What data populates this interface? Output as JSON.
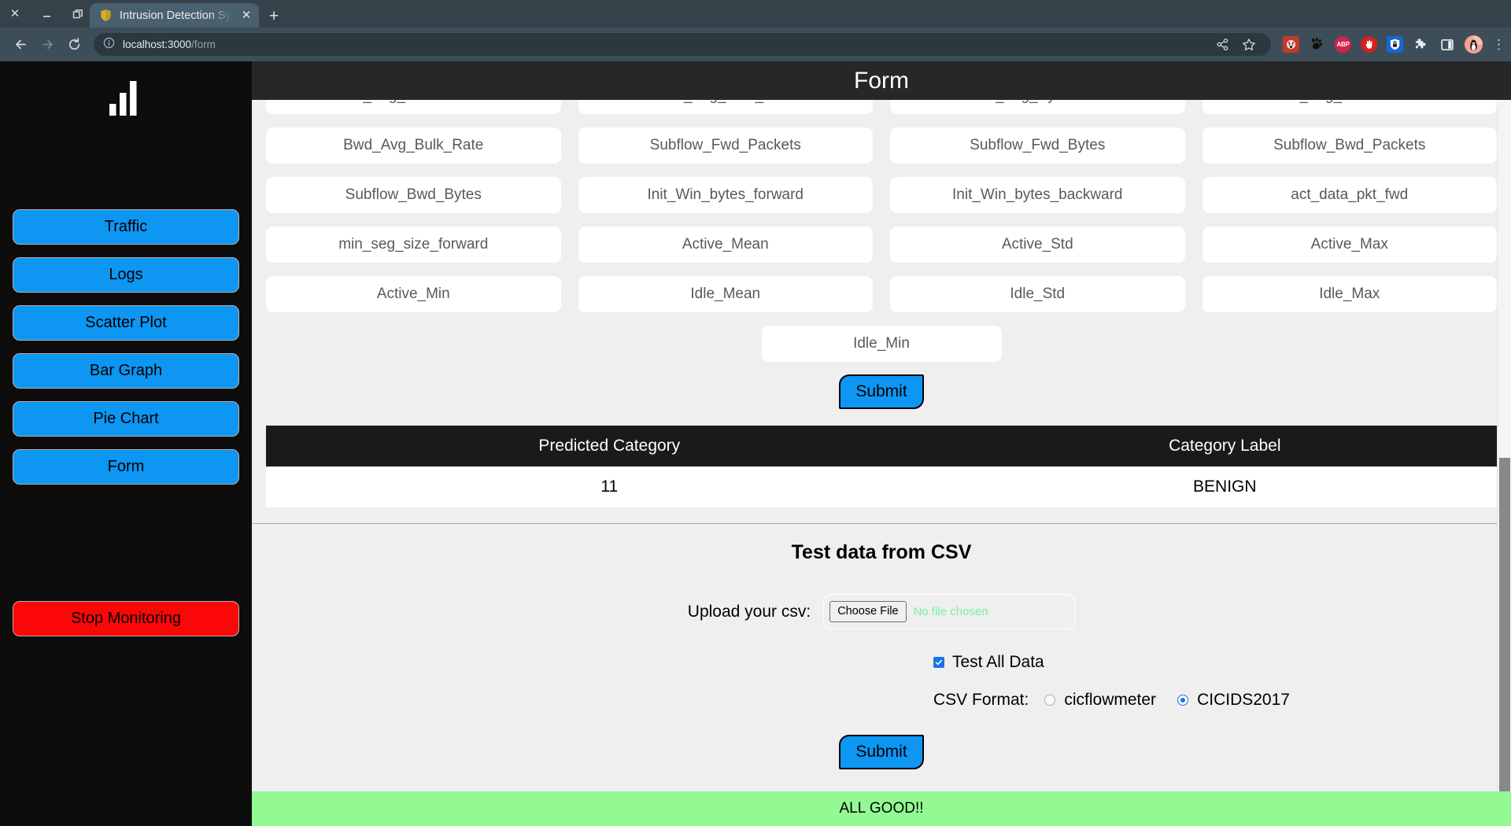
{
  "browser": {
    "window_controls": {
      "close": "close-icon",
      "minimize": "minimize-icon",
      "restore": "restore-icon"
    },
    "tab": {
      "title": "Intrusion Detection Syst",
      "favicon": "shield-icon",
      "close": "close-icon"
    },
    "new_tab_label": "+",
    "nav": {
      "back": "back-arrow-icon",
      "forward": "forward-arrow-icon",
      "reload": "reload-icon"
    },
    "omnibox": {
      "info_icon": "info-circle-icon",
      "url_host": "localhost:3000",
      "url_path": "/form"
    },
    "omnibox_actions": {
      "share": "share-icon",
      "bookmark": "star-icon"
    },
    "extensions": [
      {
        "name": "noscript-extension-icon",
        "label": ""
      },
      {
        "name": "gnome-extension-icon",
        "label": ""
      },
      {
        "name": "adblock-plus-extension-icon",
        "label": "ABP"
      },
      {
        "name": "stop-hand-extension-icon",
        "label": ""
      },
      {
        "name": "privacy-badger-extension-icon",
        "label": ""
      },
      {
        "name": "puzzle-extensions-icon",
        "label": ""
      },
      {
        "name": "sidepanel-icon",
        "label": ""
      }
    ],
    "avatar": "penguin-avatar",
    "menu": "three-dot-menu-icon"
  },
  "sidebar": {
    "logo": "bar-chart-logo",
    "items": [
      {
        "label": "Traffic"
      },
      {
        "label": "Logs"
      },
      {
        "label": "Scatter Plot"
      },
      {
        "label": "Bar Graph"
      },
      {
        "label": "Pie Chart"
      },
      {
        "label": "Form"
      }
    ],
    "stop_button": {
      "label": "Stop Monitoring",
      "color": "#fb0707"
    },
    "accent_color": "#0d96f2"
  },
  "header": {
    "title": "Form"
  },
  "form": {
    "fields": [
      {
        "placeholder": "Fwd_Avg_Packets/Bulk",
        "value": ""
      },
      {
        "placeholder": "Fwd_Avg_Bulk_Rate",
        "value": ""
      },
      {
        "placeholder": "Bwd_Avg_Bytes/Bulk",
        "value": ""
      },
      {
        "placeholder": "Bwd_Avg_Packets/Bulk",
        "value": ""
      },
      {
        "placeholder": "Bwd_Avg_Bulk_Rate",
        "value": ""
      },
      {
        "placeholder": "Subflow_Fwd_Packets",
        "value": ""
      },
      {
        "placeholder": "Subflow_Fwd_Bytes",
        "value": ""
      },
      {
        "placeholder": "Subflow_Bwd_Packets",
        "value": ""
      },
      {
        "placeholder": "Subflow_Bwd_Bytes",
        "value": ""
      },
      {
        "placeholder": "Init_Win_bytes_forward",
        "value": ""
      },
      {
        "placeholder": "Init_Win_bytes_backward",
        "value": ""
      },
      {
        "placeholder": "act_data_pkt_fwd",
        "value": ""
      },
      {
        "placeholder": "min_seg_size_forward",
        "value": ""
      },
      {
        "placeholder": "Active_Mean",
        "value": ""
      },
      {
        "placeholder": "Active_Std",
        "value": ""
      },
      {
        "placeholder": "Active_Max",
        "value": ""
      },
      {
        "placeholder": "Active_Min",
        "value": ""
      },
      {
        "placeholder": "Idle_Mean",
        "value": ""
      },
      {
        "placeholder": "Idle_Std",
        "value": ""
      },
      {
        "placeholder": "Idle_Max",
        "value": ""
      }
    ],
    "last_field": {
      "placeholder": "Idle_Min",
      "value": ""
    },
    "submit_label": "Submit"
  },
  "result_table": {
    "columns": [
      "Predicted Category",
      "Category Label"
    ],
    "rows": [
      [
        "11",
        "BENIGN"
      ]
    ]
  },
  "csv_section": {
    "title": "Test data from CSV",
    "upload_label": "Upload your csv:",
    "choose_file_label": "Choose File",
    "file_status": "No file chosen",
    "test_all_data_label": "Test All Data",
    "test_all_data_checked": true,
    "csv_format_label": "CSV Format:",
    "format_options": [
      {
        "label": "cicflowmeter",
        "selected": false
      },
      {
        "label": "CICIDS2017",
        "selected": true
      }
    ],
    "submit_label": "Submit"
  },
  "status_bar": {
    "text": "ALL GOOD!!",
    "background": "#93fa93"
  }
}
